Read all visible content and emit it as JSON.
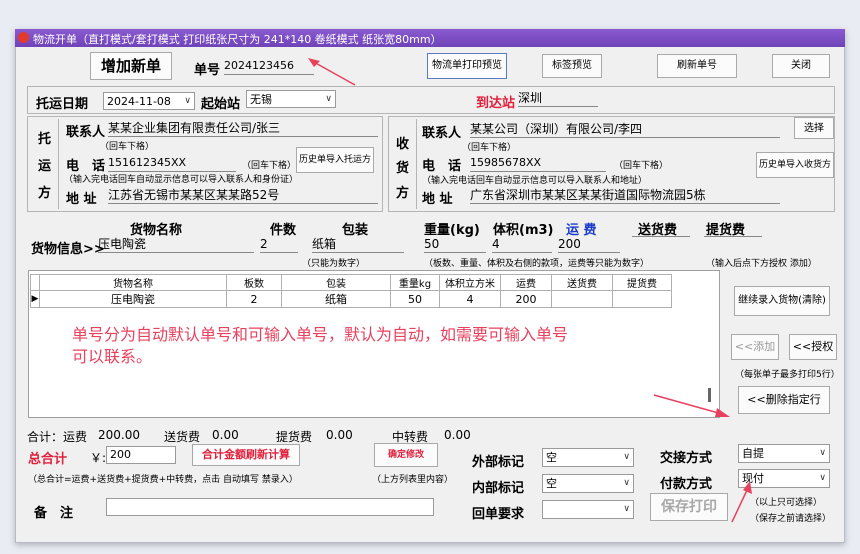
{
  "window": {
    "title": "物流开单（直打模式/套打模式 打印纸张尺寸为 241*140 卷纸模式 纸张宽80mm）"
  },
  "toolbar": {
    "add_new": "增加新单",
    "order_no_label": "单号",
    "order_no": "2024123456",
    "print_preview": "物流单打印预览",
    "label_preview": "标签预览",
    "refresh_no": "刷新单号",
    "close": "关闭"
  },
  "route": {
    "date_label": "托运日期",
    "date": "2024-11-08",
    "origin_label": "起始站",
    "origin": "无锡",
    "dest_label": "到达站",
    "dest": "深圳"
  },
  "shipper": {
    "side_label": [
      "托",
      "运",
      "方"
    ],
    "contact_label": "联系人",
    "contact": "某某企业集团有限责任公司/张三",
    "contact_hint": "（回车下格）",
    "phone_label": "电　话",
    "phone": "151612345XX",
    "phone_hint": "（回车下格）",
    "phone_note": "（输入完电话回车自动显示信息可以导入联系人和身份证）",
    "history_btn": "历史单导入托运方",
    "addr_label": "地 址",
    "addr": "江苏省无锡市某某区某某路52号"
  },
  "consignee": {
    "side_label": [
      "收",
      "货",
      "方"
    ],
    "select_btn": "选择",
    "contact_label": "联系人",
    "contact": "某某公司（深圳）有限公司/李四",
    "contact_hint": "（回车下格）",
    "phone_label": "电　话",
    "phone": "15985678XX",
    "phone_hint": "（回车下格）",
    "phone_note": "（输入完电话回车自动显示信息可以导入联系人和地址）",
    "history_btn": "历史单导入收货方",
    "addr_label": "地 址",
    "addr": "广东省深圳市某某区某某街道国际物流园5栋"
  },
  "goods": {
    "headers": {
      "name": "货物名称",
      "count": "件数",
      "pack": "包装",
      "weight": "重量(kg)",
      "volume": "体积(m3)",
      "freight": "运 费",
      "delivery": "送货费",
      "pickup": "提货费"
    },
    "row_label": "货物信息>>",
    "name": "压电陶瓷",
    "count": "2",
    "pack": "纸箱",
    "weight": "50",
    "volume": "4",
    "freight": "200",
    "delivery": "",
    "pickup": "",
    "hint_pack": "（只能为数字）",
    "hint_mid": "（板数、重量、体积及右侧的款项，运费等只能为数字）",
    "hint_right": "（输入后点下方授权 添加）"
  },
  "grid": {
    "columns": [
      "货物名称",
      "板数",
      "包装",
      "重量kg",
      "体积立方米",
      "运费",
      "送货费",
      "提货费"
    ],
    "rows": [
      [
        "压电陶瓷",
        "2",
        "纸箱",
        "50",
        "4",
        "200",
        "",
        ""
      ]
    ]
  },
  "side_buttons": {
    "continue": "继续录入货物(清除)",
    "add": "<<添加",
    "authorize": "<<授权",
    "note": "（每张单子最多打印5行）",
    "delete": "<<删除指定行"
  },
  "annotation": {
    "line1": "单号分为自动默认单号和可输入单号，默认为自动，如需要可输入单号",
    "line2": "可以联系。"
  },
  "summary": {
    "freight_label": "合计：运费",
    "freight": "200.00",
    "delivery_label": "送货费",
    "delivery": "0.00",
    "pickup_label": "提货费",
    "pickup": "0.00",
    "transfer_label": "中转费",
    "transfer": "0.00",
    "total_label": "总合计",
    "currency": "￥:",
    "total": "200",
    "recalc_btn": "合计金额刷新计算",
    "confirm_btn": "确定修改",
    "formula": "（总合计=运费+送货费+提货费+中转费，点击  自动填写 禁录入）",
    "list_note": "（上方列表里内容）",
    "remark_label": "备　注",
    "remark": ""
  },
  "options": {
    "external_label": "外部标记",
    "external": "空",
    "internal_label": "内部标记",
    "internal": "空",
    "receipt_label": "回单要求",
    "receipt": "",
    "handover_label": "交接方式",
    "handover": "自提",
    "payment_label": "付款方式",
    "payment": "现付",
    "save_print": "保存打印",
    "note1": "（以上只可选择）",
    "note2": "（保存之前请选择）"
  },
  "colors": {
    "accent": "#e0203c",
    "titlebar": "#7a4cc0",
    "annotation": "#e8415e"
  }
}
